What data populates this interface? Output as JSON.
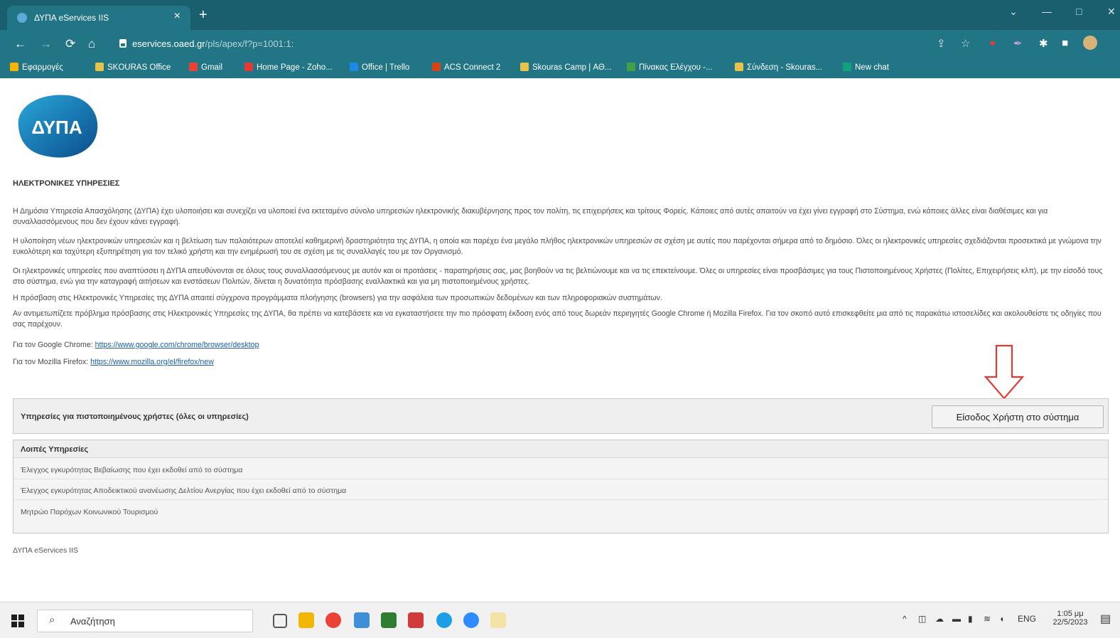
{
  "browser": {
    "tab_title": "ΔΥΠΑ eServices IIS",
    "tab_close": "×",
    "new_tab": "+",
    "url_host": "eservices.oaed.gr",
    "url_path": "/pls/apex/f?p=1001:1:",
    "window_controls": [
      "⌄",
      "—",
      "□",
      "✕"
    ]
  },
  "bookmarks": [
    {
      "label": "Εφαρμογές",
      "color": "#f4b400"
    },
    {
      "label": "SKOURAS Office",
      "color": "#e8c34a"
    },
    {
      "label": "Gmail",
      "color": "#ea4335"
    },
    {
      "label": "Home Page - Zoho...",
      "color": "#e53935"
    },
    {
      "label": "Office | Trello",
      "color": "#1e88e5"
    },
    {
      "label": "ACS Connect 2",
      "color": "#d84315"
    },
    {
      "label": "Skouras Camp | ΑΘ...",
      "color": "#e8c34a"
    },
    {
      "label": "Πίνακας Ελέγχου -...",
      "color": "#43a047"
    },
    {
      "label": "Σύνδεση - Skouras...",
      "color": "#e8c34a"
    },
    {
      "label": "New chat",
      "color": "#10a37f"
    }
  ],
  "page": {
    "logo_text": "ΔΥΠΑ",
    "heading": "ΗΛΕΚΤΡΟΝΙΚΕΣ ΥΠΗΡΕΣΙΕΣ",
    "paragraphs": [
      "Η Δημόσια Υπηρεσία Απασχόλησης (ΔΥΠΑ) έχει υλοποιήσει και συνεχίζει να υλοποιεί ένα εκτεταμένο σύνολο υπηρεσιών ηλεκτρονικής διακυβέρνησης προς τον πολίτη, τις επιχειρήσεις και τρίτους Φορείς. Κάποιες από αυτές απαιτούν να έχει γίνει εγγραφή στο Σύστημα, ενώ κάποιες άλλες είναι διαθέσιμες και για συναλλασσόμενους που δεν έχουν κάνει εγγραφή.",
      "Η υλοποίηση νέων ηλεκτρονικών υπηρεσιών και η βελτίωση των παλαιότερων αποτελεί καθημερινή δραστηριότητα της ΔΥΠΑ, η οποία και παρέχει ένα μεγάλο πλήθος ηλεκτρονικών υπηρεσιών σε σχέση με αυτές που παρέχονται σήμερα από το δημόσιο. Όλες οι ηλεκτρονικές υπηρεσίες σχεδιάζονται προσεκτικά με γνώμονα την ευκολότερη και ταχύτερη εξυπηρέτηση για τον τελικό χρήστη και την ενημέρωσή του σε σχέση με τις συναλλαγές του με τον Οργανισμό.",
      "Οι ηλεκτρονικές υπηρεσίες που αναπτύσσει η ΔΥΠΑ απευθύνονται σε όλους τους συναλλασσόμενους με αυτόν και οι προτάσεις - παρατηρήσεις σας, μας βοηθούν να τις βελτιώνουμε και να τις επεκτείνουμε. Όλες οι υπηρεσίες είναι προσβάσιμες για τους Πιστοποιημένους Χρήστες (Πολίτες, Επιχειρήσεις κλπ), με την είσοδό τους στο σύστημα, ενώ για την καταγραφή αιτήσεων και ενστάσεων Πολιτών, δίνεται η δυνατότητα πρόσβασης εναλλακτικά και για μη πιστοποιημένους χρήστες.",
      "Η πρόσβαση στις Ηλεκτρονικές Υπηρεσίες της ΔΥΠΑ απαιτεί σύγχρονα προγράμματα πλοήγησης (browsers) για την ασφάλεια των προσωπικών δεδομένων και των πληροφοριακών συστημάτων.",
      "Αν αντιμετωπίζετε πρόβλημα πρόσβασης στις Ηλεκτρονικές Υπηρεσίες της ΔΥΠΑ, θα πρέπει να κατεβάσετε και να εγκαταστήσετε την πιο πρόσφατη έκδοση ενός από τους δωρεάν περιηγητές Google Chrome ή Mozilla Firefox. Για τον σκοπό αυτό επισκεφθείτε μια από τις παρακάτω ιστοσελίδες και ακολουθείστε τις οδηγίες που σας παρέχουν."
    ],
    "chrome_label": "Για τον Google Chrome:",
    "chrome_link": "https://www.google.com/chrome/browser/desktop",
    "firefox_label": "Για τον Mozilla Firefox:",
    "firefox_link": "https://www.mozilla.org/el/firefox/new",
    "certified_title": "Υπηρεσίες για πιστοποιημένους χρήστες (όλες οι υπηρεσίες)",
    "login_button": "Είσοδος Χρήστη στο σύστημα",
    "other_title": "Λοιπές Υπηρεσίες",
    "other_services": [
      "Έλεγχος εγκυρότητας Βεβαίωσης που έχει εκδοθεί από το σύστημα",
      "Έλεγχος εγκυρότητας Αποδεικτικού ανανέωσης Δελτίου Ανεργίας που έχει εκδοθεί από το σύστημα",
      "Μητρώο Παρόχων Κοινωνικού Τουρισμού"
    ],
    "footer": "ΔΥΠΑ eServices IIS",
    "arrow_color": "#e53935"
  },
  "taskbar": {
    "search_placeholder": "Αναζήτηση",
    "lang": "ENG",
    "time": "1:05 μμ",
    "date": "22/5/2023"
  }
}
